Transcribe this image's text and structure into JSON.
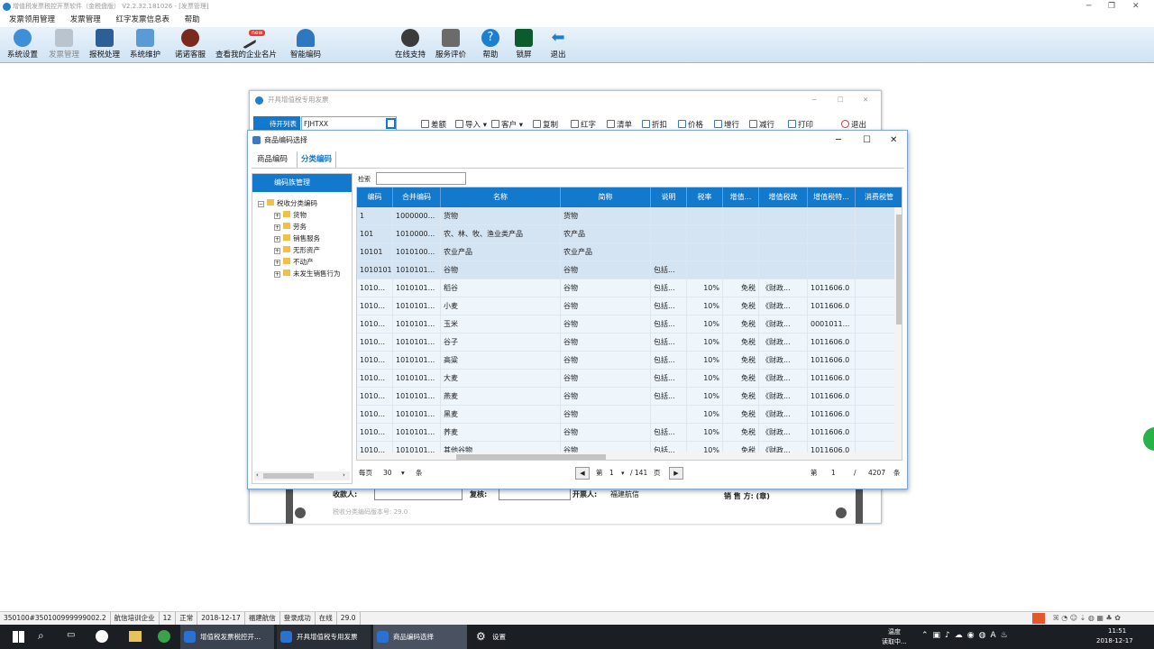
{
  "window": {
    "title": "增值税发票税控开票软件（金税盘版） V2.2.32.181026 - [发票管理]"
  },
  "menu": [
    "发票领用管理",
    "发票管理",
    "红字发票信息表",
    "帮助"
  ],
  "toolbar": {
    "items": [
      "系统设置",
      "发票管理",
      "报税处理",
      "系统维护",
      "诺诺客服",
      "查看我的企业名片",
      "智能编码",
      "在线支持",
      "服务评价",
      "帮助",
      "锁屏",
      "退出"
    ],
    "new_badge": "new"
  },
  "invoice_window": {
    "title": "开具增值税专用发票",
    "pending_label": "待开列表",
    "code": "FJHTXX",
    "tools": [
      "差额",
      "导入 ▾",
      "客户 ▾",
      "复制",
      "红字",
      "清单",
      "折扣",
      "价格",
      "增行",
      "减行",
      "打印",
      "退出"
    ],
    "payee_label": "收款人:",
    "reviewer_label": "复核:",
    "drawer_label": "开票人:",
    "drawer_value": "福建航信",
    "seller_label": "销 售 方: (章)",
    "version_note": "税收分类编码版本号: 29.0"
  },
  "dialog": {
    "title": "商品编码选择",
    "tabs": [
      "商品编码",
      "分类编码"
    ],
    "active_tab": "分类编码",
    "left_header": "编码族管理",
    "tree": {
      "root": "税收分类编码",
      "children": [
        "货物",
        "劳务",
        "销售服务",
        "无形资产",
        "不动产",
        "未发生销售行为"
      ]
    },
    "search_label": "检索",
    "columns": [
      "编码",
      "合并编码",
      "名称",
      "简称",
      "说明",
      "税率",
      "增值...",
      "增值税政",
      "增值税特...",
      "消费税管"
    ],
    "rows": [
      [
        "1",
        "1000000...",
        "货物",
        "货物",
        "",
        "",
        "",
        "",
        "",
        ""
      ],
      [
        "101",
        "1010000...",
        "农、林、牧、渔业类产品",
        "农产品",
        "",
        "",
        "",
        "",
        "",
        ""
      ],
      [
        "10101",
        "1010100...",
        "农业产品",
        "农业产品",
        "",
        "",
        "",
        "",
        "",
        ""
      ],
      [
        "1010101",
        "1010101...",
        "谷物",
        "谷物",
        "包括...",
        "",
        "",
        "",
        "",
        ""
      ],
      [
        "1010...",
        "1010101...",
        "稻谷",
        "谷物",
        "包括...",
        "10%",
        "免税",
        "《财政...",
        "1011606.0",
        ""
      ],
      [
        "1010...",
        "1010101...",
        "小麦",
        "谷物",
        "包括...",
        "10%",
        "免税",
        "《财政...",
        "1011606.0",
        ""
      ],
      [
        "1010...",
        "1010101...",
        "玉米",
        "谷物",
        "包括...",
        "10%",
        "免税",
        "《财政...",
        "0001011...",
        ""
      ],
      [
        "1010...",
        "1010101...",
        "谷子",
        "谷物",
        "包括...",
        "10%",
        "免税",
        "《财政...",
        "1011606.0",
        ""
      ],
      [
        "1010...",
        "1010101...",
        "高粱",
        "谷物",
        "包括...",
        "10%",
        "免税",
        "《财政...",
        "1011606.0",
        ""
      ],
      [
        "1010...",
        "1010101...",
        "大麦",
        "谷物",
        "包括...",
        "10%",
        "免税",
        "《财政...",
        "1011606.0",
        ""
      ],
      [
        "1010...",
        "1010101...",
        "燕麦",
        "谷物",
        "包括...",
        "10%",
        "免税",
        "《财政...",
        "1011606.0",
        ""
      ],
      [
        "1010...",
        "1010101...",
        "黑麦",
        "谷物",
        "",
        "10%",
        "免税",
        "《财政...",
        "1011606.0",
        ""
      ],
      [
        "1010...",
        "1010101...",
        "荞麦",
        "谷物",
        "包括...",
        "10%",
        "免税",
        "《财政...",
        "1011606.0",
        ""
      ],
      [
        "1010...",
        "1010101...",
        "其他谷物",
        "谷物",
        "包括...",
        "10%",
        "免税",
        "《财政...",
        "1011606.0",
        ""
      ]
    ],
    "pager": {
      "per_page_label": "每页",
      "per_page": "30",
      "unit": "条",
      "page_label": "第",
      "page": "1",
      "total_pages": "/ 141",
      "page_unit": "页",
      "record_label": "第",
      "record": "1",
      "slash": "/",
      "total_records": "4207",
      "record_unit": "条"
    }
  },
  "statusbar": [
    "350100#350100999999002.2",
    "航信培训企业",
    "12",
    "正常",
    "2018-12-17",
    "福建航信",
    "登录成功",
    "在线",
    "29.0"
  ],
  "taskbar": {
    "tasks": [
      "增值税发票税控开...",
      "开具增值税专用发票",
      "商品编码选择",
      "设置"
    ],
    "weather": "温度",
    "weather_sub": "读取中...",
    "time": "11:51",
    "date": "2018-12-17"
  },
  "colors": {
    "accent": "#1379cc",
    "selected_row": "#d5e4f3",
    "row": "#eef6fc"
  }
}
